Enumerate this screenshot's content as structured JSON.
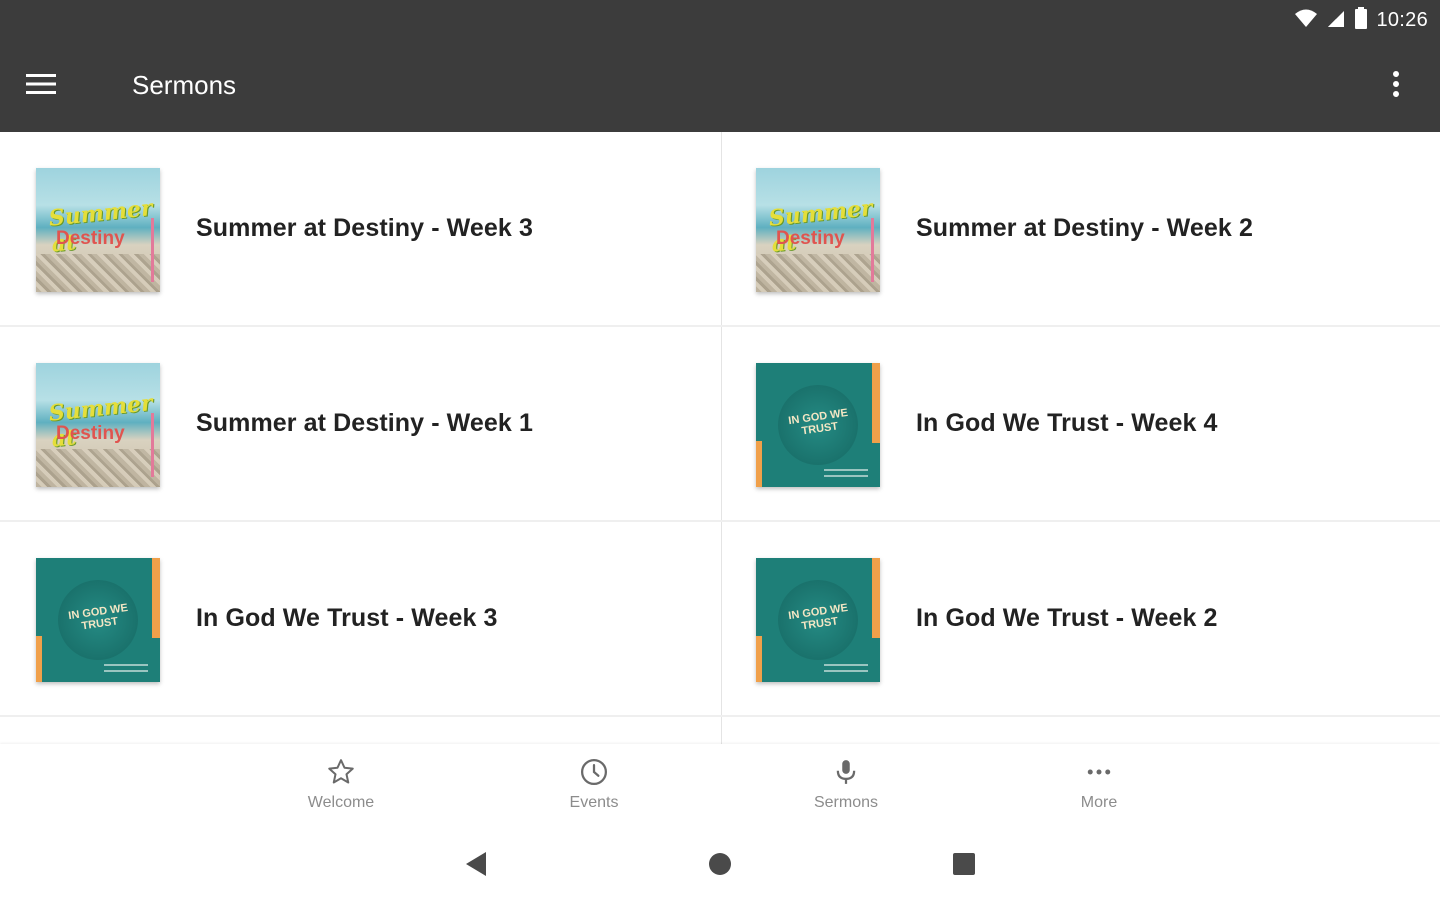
{
  "status_bar": {
    "time": "10:26"
  },
  "app_bar": {
    "title": "Sermons"
  },
  "sermons": [
    {
      "title": "Summer at Destiny - Week 3",
      "art": "summer",
      "art_text_1": "Summer at",
      "art_text_2": "Destiny"
    },
    {
      "title": "Summer at Destiny - Week 2",
      "art": "summer",
      "art_text_1": "Summer at",
      "art_text_2": "Destiny"
    },
    {
      "title": "Summer at Destiny - Week 1",
      "art": "summer",
      "art_text_1": "Summer at",
      "art_text_2": "Destiny"
    },
    {
      "title": "In God We Trust - Week 4",
      "art": "trust",
      "art_text_1": "IN GOD WE TRUST"
    },
    {
      "title": "In God We Trust - Week 3",
      "art": "trust",
      "art_text_1": "IN GOD WE TRUST"
    },
    {
      "title": "In God We Trust - Week 2",
      "art": "trust",
      "art_text_1": "IN GOD WE TRUST"
    }
  ],
  "bottom_nav": [
    {
      "label": "Welcome",
      "icon": "star-icon"
    },
    {
      "label": "Events",
      "icon": "clock-icon"
    },
    {
      "label": "Sermons",
      "icon": "microphone-icon"
    },
    {
      "label": "More",
      "icon": "more-horizontal-icon"
    }
  ],
  "system_nav": {
    "back": "back-icon",
    "home": "home-icon",
    "recents": "recents-icon"
  },
  "colors": {
    "app_bar": "#3c3c3c",
    "nav_label": "#8c8c8c",
    "trust_teal": "#1e7f78",
    "trust_orange": "#f0a04a"
  }
}
